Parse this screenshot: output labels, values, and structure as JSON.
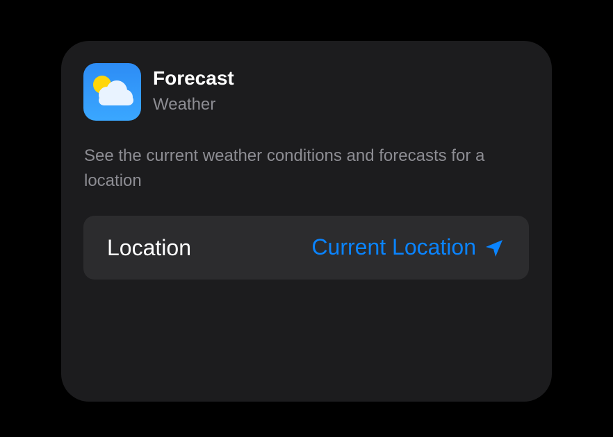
{
  "widget": {
    "app_name": "Forecast",
    "app_subtitle": "Weather",
    "description": "See the current weather conditions and forecasts for a location",
    "app_icon": "weather-cloud-sun-icon"
  },
  "settings": {
    "location_label": "Location",
    "location_value": "Current Location",
    "location_icon": "location-arrow-icon"
  },
  "colors": {
    "background": "#000000",
    "card": "#1c1c1e",
    "row": "#2c2c2e",
    "accent": "#0a84ff",
    "secondary_text": "#8d8d93"
  }
}
